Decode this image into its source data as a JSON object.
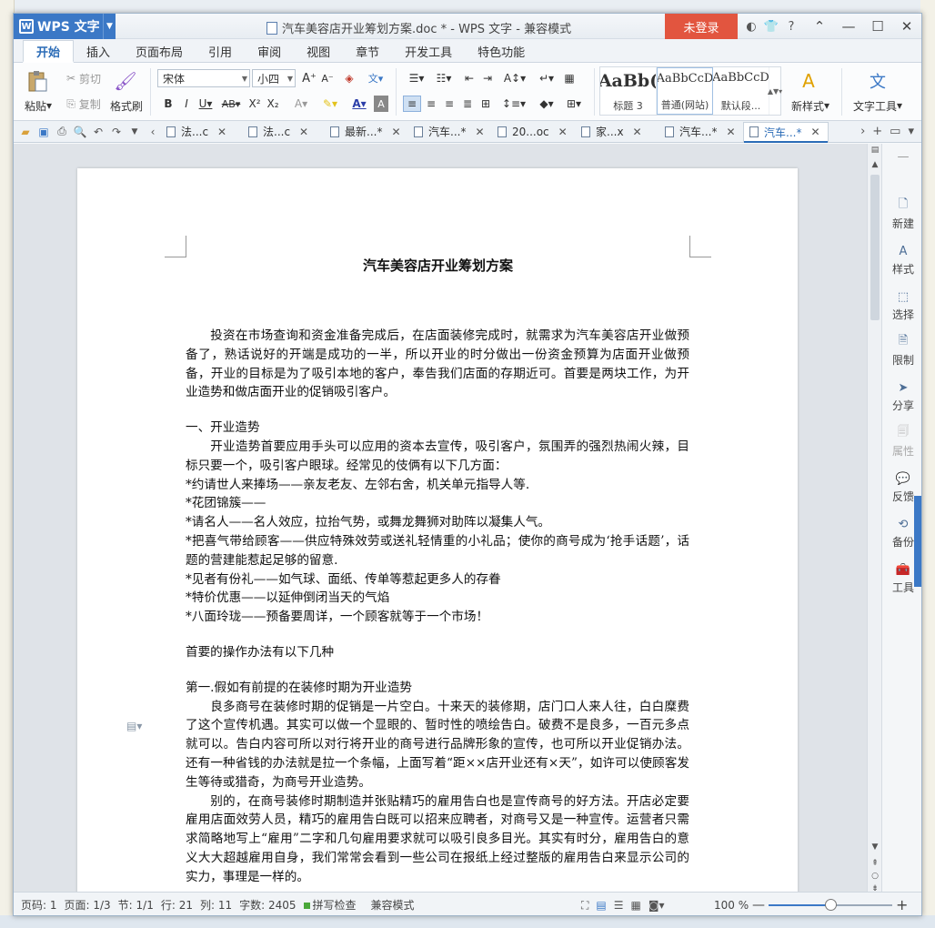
{
  "app": {
    "name": "WPS 文字",
    "window_title": "汽车美容店开业筹划方案.doc * - WPS 文字 - 兼容模式",
    "login_label": "未登录"
  },
  "menu": {
    "tabs": [
      "开始",
      "插入",
      "页面布局",
      "引用",
      "审阅",
      "视图",
      "章节",
      "开发工具",
      "特色功能"
    ]
  },
  "ribbon": {
    "paste": "粘贴",
    "cut": "剪切",
    "copy": "复制",
    "format_painter": "格式刷",
    "font_name": "宋体",
    "font_size": "小四",
    "styles": [
      {
        "preview": "AaBb(",
        "label": "标题 3"
      },
      {
        "preview": "AaBbCcD",
        "label": "普通(网站)"
      },
      {
        "preview": "AaBbCcD",
        "label": "默认段..."
      }
    ],
    "new_style": "新样式",
    "text_tools": "文字工具"
  },
  "doc_tabs": [
    {
      "label": "法...c",
      "active": false
    },
    {
      "label": "法...c",
      "active": false
    },
    {
      "label": "最新...*",
      "active": false
    },
    {
      "label": "汽车...*",
      "active": false
    },
    {
      "label": "20...oc",
      "active": false
    },
    {
      "label": "家...x",
      "active": false
    },
    {
      "label": "汽车...*",
      "active": false
    },
    {
      "label": "汽车...*",
      "active": true
    }
  ],
  "document": {
    "title": "汽车美容店开业筹划方案",
    "paragraphs": [
      "投资在市场查询和资金准备完成后，在店面装修完成时，就需求为汽车美容店开业做预备了，熟话说好的开端是成功的一半，所以开业的时分做出一份资金预算为店面开业做预备，开业的目标是为了吸引本地的客户，奉告我们店面的存期近可。首要是两块工作，为开业造势和做店面开业的促销吸引客户。",
      "一、开业造势",
      "开业造势首要应用手头可以应用的资本去宣传，吸引客户，氛围弄的强烈热闹火辣，目标只要一个，吸引客户眼球。经常见的伎俩有以下几方面：",
      "*约请世人来捧场——亲友老友、左邻右舍，机关单元指导人等.",
      "*花团锦簇——",
      "*请名人——名人效应，拉抬气势，或舞龙舞狮对助阵以凝集人气。",
      "*把喜气带给顾客——供应特殊效劳或送礼轻情重的小礼品；使你的商号成为‘抢手话题’，话题的营建能惹起足够的留意.",
      "*见者有份礼——如气球、面纸、传单等惹起更多人的存眷",
      "*特价优惠——以延伸倒闭当天的气焰",
      "*八面玲珑——预备要周详，一个顾客就等于一个市场！",
      "首要的操作办法有以下几种",
      "第一.假如有前提的在装修时期为开业造势",
      "良多商号在装修时期的促销是一片空白。十来天的装修期，店门口人来人往，白白糜费了这个宣传机遇。其实可以做一个显眼的、暂时性的喷绘告白。破费不是良多，一百元多点就可以。告白内容可所以对行将开业的商号进行品牌形象的宣传，也可所以开业促销办法。还有一种省钱的办法就是拉一个条幅，上面写着“距××店开业还有×天”，如许可以使顾客发生等待或猎奇，为商号开业造势。",
      "别的，在商号装修时期制造并张贴精巧的雇用告白也是宣传商号的好方法。开店必定要雇用店面效劳人员，精巧的雇用告白既可以招来应聘者，对商号又是一种宣传。运营者只需求简略地写上“雇用”二字和几句雇用要求就可以吸引良多目光。其实有时分，雇用告白的意义大大超越雇用自身，我们常常会看到一些公司在报纸上经过整版的雇用告白来显示公司的实力，事理是一样的。"
    ]
  },
  "sidebar": {
    "items": [
      "新建",
      "样式",
      "选择",
      "限制",
      "分享",
      "属性",
      "反馈",
      "备份",
      "工具"
    ]
  },
  "status": {
    "page_code": "页码: 1",
    "pages": "页面: 1/3",
    "section": "节: 1/1",
    "line": "行: 21",
    "column": "列: 11",
    "word_count": "字数: 2405",
    "spell_check": "拼写检查",
    "compat_mode": "兼容模式",
    "zoom": "100 %",
    "zoom_level": 0.5
  },
  "colors": {
    "accent": "#2b6cb7",
    "wps_blue": "#3b78c6",
    "login_red": "#e2553f"
  }
}
